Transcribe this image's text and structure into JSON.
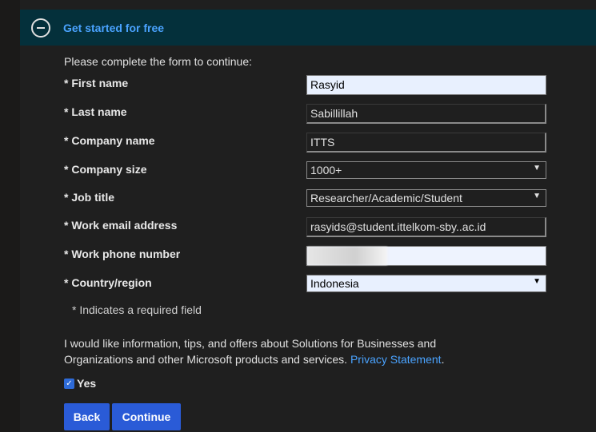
{
  "section": {
    "title": "Get started for free",
    "collapse_icon": "minus-circle-icon"
  },
  "form": {
    "intro": "Please complete the form to continue:",
    "fields": [
      {
        "label": "* First name",
        "value": "Rasyid",
        "type": "text"
      },
      {
        "label": "* Last name",
        "value": "Sabillillah",
        "type": "text"
      },
      {
        "label": "* Company name",
        "value": "ITTS",
        "type": "text"
      },
      {
        "label": "* Company size",
        "value": "1000+",
        "type": "select"
      },
      {
        "label": "* Job title",
        "value": "Researcher/Academic/Student",
        "type": "select"
      },
      {
        "label": "* Work email address",
        "value": "rasyids@student.ittelkom-sby..ac.id",
        "type": "text"
      },
      {
        "label": "* Work phone number",
        "value": "",
        "type": "text"
      },
      {
        "label": "* Country/region",
        "value": "Indonesia",
        "type": "select"
      }
    ],
    "required_note": "* Indicates a required field",
    "consent_text": "I would like information, tips, and offers about Solutions for Businesses and Organizations and other Microsoft products and services.",
    "privacy_link": "Privacy Statement",
    "consent_period": ".",
    "checkbox_label": "Yes",
    "checkbox_checked": true
  },
  "buttons": {
    "back": "Back",
    "continue": "Continue"
  },
  "colors": {
    "header_bg": "#04303b",
    "link": "#4aa3ff",
    "button": "#2a5bd7"
  }
}
